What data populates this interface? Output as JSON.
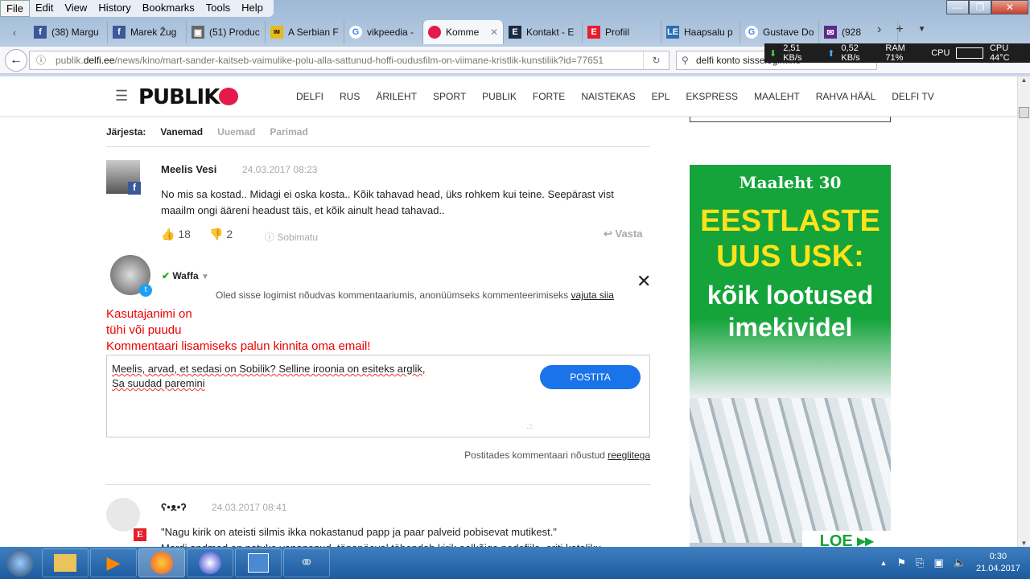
{
  "menu": [
    "File",
    "Edit",
    "View",
    "History",
    "Bookmarks",
    "Tools",
    "Help"
  ],
  "tabs": [
    {
      "label": "(38) Margu",
      "icon": "facebook-icon",
      "color": "#3b5998",
      "glyph": "f"
    },
    {
      "label": "Marek Žug",
      "icon": "facebook-icon",
      "color": "#3b5998",
      "glyph": "f"
    },
    {
      "label": "(51) Produc",
      "icon": "briefcase-icon",
      "color": "#666",
      "glyph": "▣"
    },
    {
      "label": "A Serbian F",
      "icon": "imdb-icon",
      "color": "#e6b91e",
      "glyph": "IM"
    },
    {
      "label": "vikpeedia -",
      "icon": "google-icon",
      "color": "#fff",
      "glyph": "G"
    },
    {
      "label": "Komme",
      "icon": "delfi-icon",
      "color": "#e6194b",
      "glyph": ""
    },
    {
      "label": "Kontakt - E",
      "icon": "ekspress-icon",
      "color": "#1a2a40",
      "glyph": "E"
    },
    {
      "label": "Profiil",
      "icon": "ekspress-icon",
      "color": "#e61e2a",
      "glyph": "E"
    },
    {
      "label": "Haapsalu p",
      "icon": "le-icon",
      "color": "#2a6db5",
      "glyph": "LE"
    },
    {
      "label": "Gustave Do",
      "icon": "google-icon",
      "color": "#fff",
      "glyph": "G"
    },
    {
      "label": "(928",
      "icon": "mail-icon",
      "color": "#5b2a8a",
      "glyph": "✉"
    }
  ],
  "url": {
    "prefix": "publik.",
    "domain": "delfi.ee",
    "path": "/news/kino/mart-sander-kaitseb-vaimulike-polu-alla-sattunud-hoffi-oudusfilm-on-viimane-kristlik-kunstiliik?id=77651"
  },
  "search": "delfi konto sisselogimine",
  "netmon": {
    "down": "2,51 KB/s",
    "up": "0,52 KB/s",
    "ram": "RAM 71%",
    "cpu": "CPU",
    "cputemp": "CPU 44°C"
  },
  "site": {
    "nav": [
      "DELFI",
      "RUS",
      "ÄRILEHT",
      "SPORT",
      "PUBLIK",
      "FORTE",
      "NAISTEKAS",
      "EPL",
      "EKSPRESS",
      "MAALEHT",
      "RAHVA HÄÄL",
      "DELFI TV"
    ],
    "sort": {
      "label": "Järjesta:",
      "options": [
        "Vanemad",
        "Uuemad",
        "Parimad"
      ]
    },
    "comment1": {
      "author": "Meelis Vesi",
      "date": "24.03.2017 08:23",
      "text1": "No mis sa kostad.. Midagi ei oska kosta.. Kõik tahavad head, üks rohkem kui teine. Seepärast vist",
      "text2": "maailm ongi ääreni headust täis, et kõik ainult head tahavad..",
      "likes": "18",
      "dislikes": "2",
      "report": "Sobimatu",
      "reply": "Vasta"
    },
    "reply_form": {
      "user": "Waffa",
      "login_note": "Oled sisse logimist nõudvas kommentaariumis, anonüümseks kommenteerimiseks",
      "login_link": "vajuta siia",
      "err1": "Kasutajanimi on",
      "err2": "tühi või puudu",
      "err3": "Kommentaari lisamiseks palun kinnita oma email!",
      "text1": "Meelis, arvad, et sedasi on Sobilik? Selline iroonia on esiteks arglik,",
      "text2": "Sa suudad paremini",
      "submit": "POSTITA",
      "rules_prefix": "Postitades kommentaari nõustud",
      "rules_link": "reeglitega"
    },
    "comment2": {
      "author": "ʕ•ᴥ•ʔ",
      "date": "24.03.2017 08:41",
      "text1": "\"Nagu kirik on ateisti silmis ikka nokastanud papp ja paar palveid pobisevat mutikest.\"",
      "text2": "Mardi andmed on natuke vananenud, tänapäeval tähendab kirik eelkõige pedofiile, eriti katoliku"
    },
    "ad": {
      "brand": "Maaleht 30",
      "line1": "EESTLASTE",
      "line2": "UUS USK:",
      "line3": "kõik lootused",
      "line4": "imekividel",
      "cta": "LOE"
    }
  },
  "clock": {
    "time": "0:30",
    "date": "21.04.2017"
  }
}
